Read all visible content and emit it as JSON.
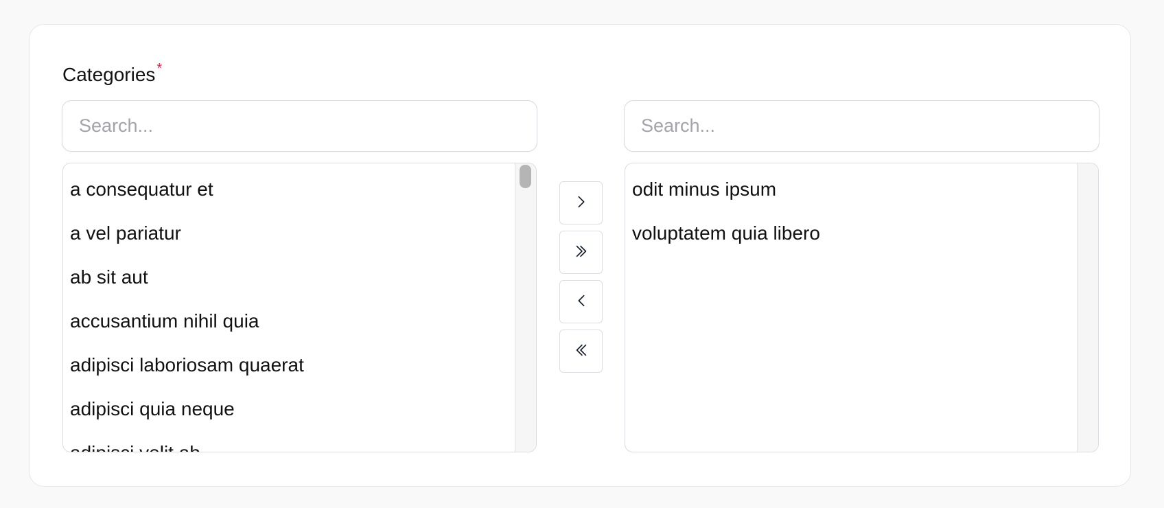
{
  "field": {
    "label": "Categories",
    "required_marker": "*"
  },
  "available": {
    "search_placeholder": "Search...",
    "items": [
      "a consequatur et",
      "a vel pariatur",
      "ab sit aut",
      "accusantium nihil quia",
      "adipisci laboriosam quaerat",
      "adipisci quia neque",
      "adipisci velit ab"
    ]
  },
  "selected": {
    "search_placeholder": "Search...",
    "items": [
      "odit minus ipsum",
      "voluptatem quia libero"
    ]
  },
  "controls": {
    "move_right_icon": "chevron-right-icon",
    "move_all_right_icon": "double-chevron-right-icon",
    "move_left_icon": "chevron-left-icon",
    "move_all_left_icon": "double-chevron-left-icon"
  },
  "colors": {
    "required": "#e11d48",
    "border": "#dcdce0",
    "background": "#f9f9f9"
  }
}
